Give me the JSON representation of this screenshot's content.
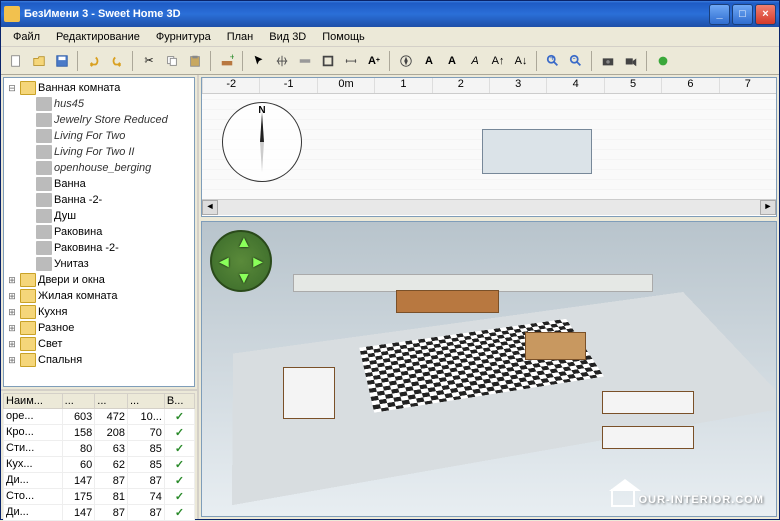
{
  "window": {
    "title": "БезИмени 3 - Sweet Home 3D"
  },
  "menu": [
    "Файл",
    "Редактирование",
    "Фурнитура",
    "План",
    "Вид 3D",
    "Помощь"
  ],
  "toolbar_icons": [
    "new-file-icon",
    "open-icon",
    "save-icon",
    "undo-icon",
    "redo-icon",
    "cut-icon",
    "copy-icon",
    "paste-icon",
    "add-furniture-icon",
    "select-icon",
    "pan-icon",
    "wall-icon",
    "room-icon",
    "dimension-icon",
    "text-icon",
    "compass-icon",
    "text-style-icon",
    "bold-icon",
    "italic-icon",
    "increase-icon",
    "decrease-icon",
    "zoom-in-icon",
    "zoom-out-icon",
    "camera-icon",
    "video-icon",
    "preferences-icon"
  ],
  "tree": {
    "root": {
      "label": "Ванная комната",
      "expanded": true
    },
    "items": [
      {
        "label": "hus45",
        "italic": true
      },
      {
        "label": "Jewelry Store Reduced",
        "italic": true
      },
      {
        "label": "Living For Two",
        "italic": true
      },
      {
        "label": "Living For Two II",
        "italic": true
      },
      {
        "label": "openhouse_berging",
        "italic": true
      },
      {
        "label": "Ванна",
        "italic": false
      },
      {
        "label": "Ванна -2-",
        "italic": false
      },
      {
        "label": "Душ",
        "italic": false
      },
      {
        "label": "Раковина",
        "italic": false
      },
      {
        "label": "Раковина -2-",
        "italic": false
      },
      {
        "label": "Унитаз",
        "italic": false
      }
    ],
    "categories": [
      "Двери и окна",
      "Жилая комната",
      "Кухня",
      "Разное",
      "Свет",
      "Спальня"
    ]
  },
  "table": {
    "headers": [
      "Наим...",
      "...",
      "...",
      "...",
      "В..."
    ],
    "rows": [
      {
        "name": "оре...",
        "c1": 603,
        "c2": 472,
        "c3": "10...",
        "v": true
      },
      {
        "name": "Кро...",
        "c1": 158,
        "c2": 208,
        "c3": 70,
        "v": true
      },
      {
        "name": "Сти...",
        "c1": 80,
        "c2": 63,
        "c3": 85,
        "v": true
      },
      {
        "name": "Кух...",
        "c1": 60,
        "c2": 62,
        "c3": 85,
        "v": true
      },
      {
        "name": "Ди...",
        "c1": 147,
        "c2": 87,
        "c3": 87,
        "v": true
      },
      {
        "name": "Сто...",
        "c1": 175,
        "c2": 81,
        "c3": 74,
        "v": true
      },
      {
        "name": "Ди...",
        "c1": 147,
        "c2": 87,
        "c3": 87,
        "v": true
      }
    ]
  },
  "ruler": [
    "-2",
    "-1",
    "0m",
    "1",
    "2",
    "3",
    "4",
    "5",
    "6",
    "7"
  ],
  "watermark": "OUR-INTERIOR.COM"
}
